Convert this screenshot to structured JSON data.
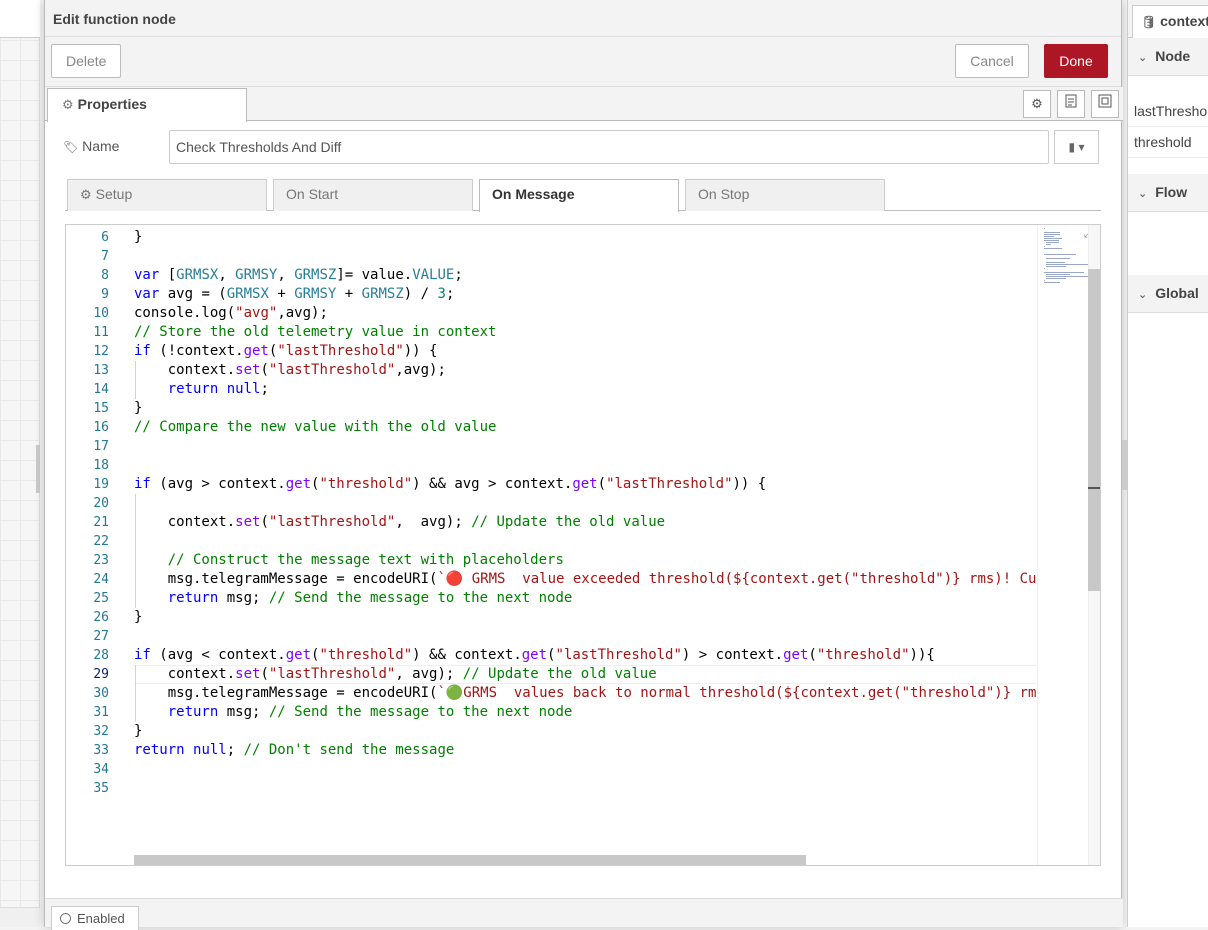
{
  "tray": {
    "title": "Edit function node",
    "delete_label": "Delete",
    "cancel_label": "Cancel",
    "done_label": "Done",
    "properties_tab": "Properties",
    "name_label": "Name",
    "name_value": "Check Thresholds And Diff",
    "enabled_label": "Enabled"
  },
  "sub_tabs": [
    {
      "label": "Setup"
    },
    {
      "label": "On Start"
    },
    {
      "label": "On Message"
    },
    {
      "label": "On Stop"
    }
  ],
  "editor": {
    "current_line": 29,
    "lines": [
      {
        "n": 6,
        "code": "}"
      },
      {
        "n": 7,
        "code": ""
      },
      {
        "n": 8,
        "code": "var [GRMSX, GRMSY, GRMSZ]= value.VALUE;"
      },
      {
        "n": 9,
        "code": "var avg = (GRMSX + GRMSY + GRMSZ) / 3;"
      },
      {
        "n": 10,
        "code": "console.log(\"avg\",avg);"
      },
      {
        "n": 11,
        "code": "// Store the old telemetry value in context"
      },
      {
        "n": 12,
        "code": "if (!context.get(\"lastThreshold\")) {"
      },
      {
        "n": 13,
        "code": "    context.set(\"lastThreshold\",avg);"
      },
      {
        "n": 14,
        "code": "    return null;"
      },
      {
        "n": 15,
        "code": "}"
      },
      {
        "n": 16,
        "code": "// Compare the new value with the old value"
      },
      {
        "n": 17,
        "code": ""
      },
      {
        "n": 18,
        "code": ""
      },
      {
        "n": 19,
        "code": "if (avg > context.get(\"threshold\") && avg > context.get(\"lastThreshold\")) {"
      },
      {
        "n": 20,
        "code": ""
      },
      {
        "n": 21,
        "code": "    context.set(\"lastThreshold\",  avg); // Update the old value"
      },
      {
        "n": 22,
        "code": ""
      },
      {
        "n": 23,
        "code": "    // Construct the message text with placeholders"
      },
      {
        "n": 24,
        "code": "    msg.telegramMessage = encodeURI(`🔴 GRMS  value exceeded threshold(${context.get(\"threshold\")} rms)! Cu"
      },
      {
        "n": 25,
        "code": "    return msg; // Send the message to the next node"
      },
      {
        "n": 26,
        "code": "}"
      },
      {
        "n": 27,
        "code": ""
      },
      {
        "n": 28,
        "code": "if (avg < context.get(\"threshold\") && context.get(\"lastThreshold\") > context.get(\"threshold\")){"
      },
      {
        "n": 29,
        "code": "    context.set(\"lastThreshold\", avg); // Update the old value"
      },
      {
        "n": 30,
        "code": "    msg.telegramMessage = encodeURI(`🟢GRMS  values back to normal threshold(${context.get(\"threshold\")} rm"
      },
      {
        "n": 31,
        "code": "    return msg; // Send the message to the next node"
      },
      {
        "n": 32,
        "code": "}"
      },
      {
        "n": 33,
        "code": "return null; // Don't send the message"
      },
      {
        "n": 34,
        "code": ""
      },
      {
        "n": 35,
        "code": ""
      }
    ]
  },
  "sidebar": {
    "tab_label": "context",
    "sections": [
      "Node",
      "Flow",
      "Global"
    ],
    "node_items": [
      "lastThreshold",
      "threshold"
    ]
  },
  "icons": {
    "gear": "gear-icon",
    "tag": "tag-icon",
    "book": "book-icon",
    "expand": "expand-icon",
    "database": "database-icon"
  }
}
